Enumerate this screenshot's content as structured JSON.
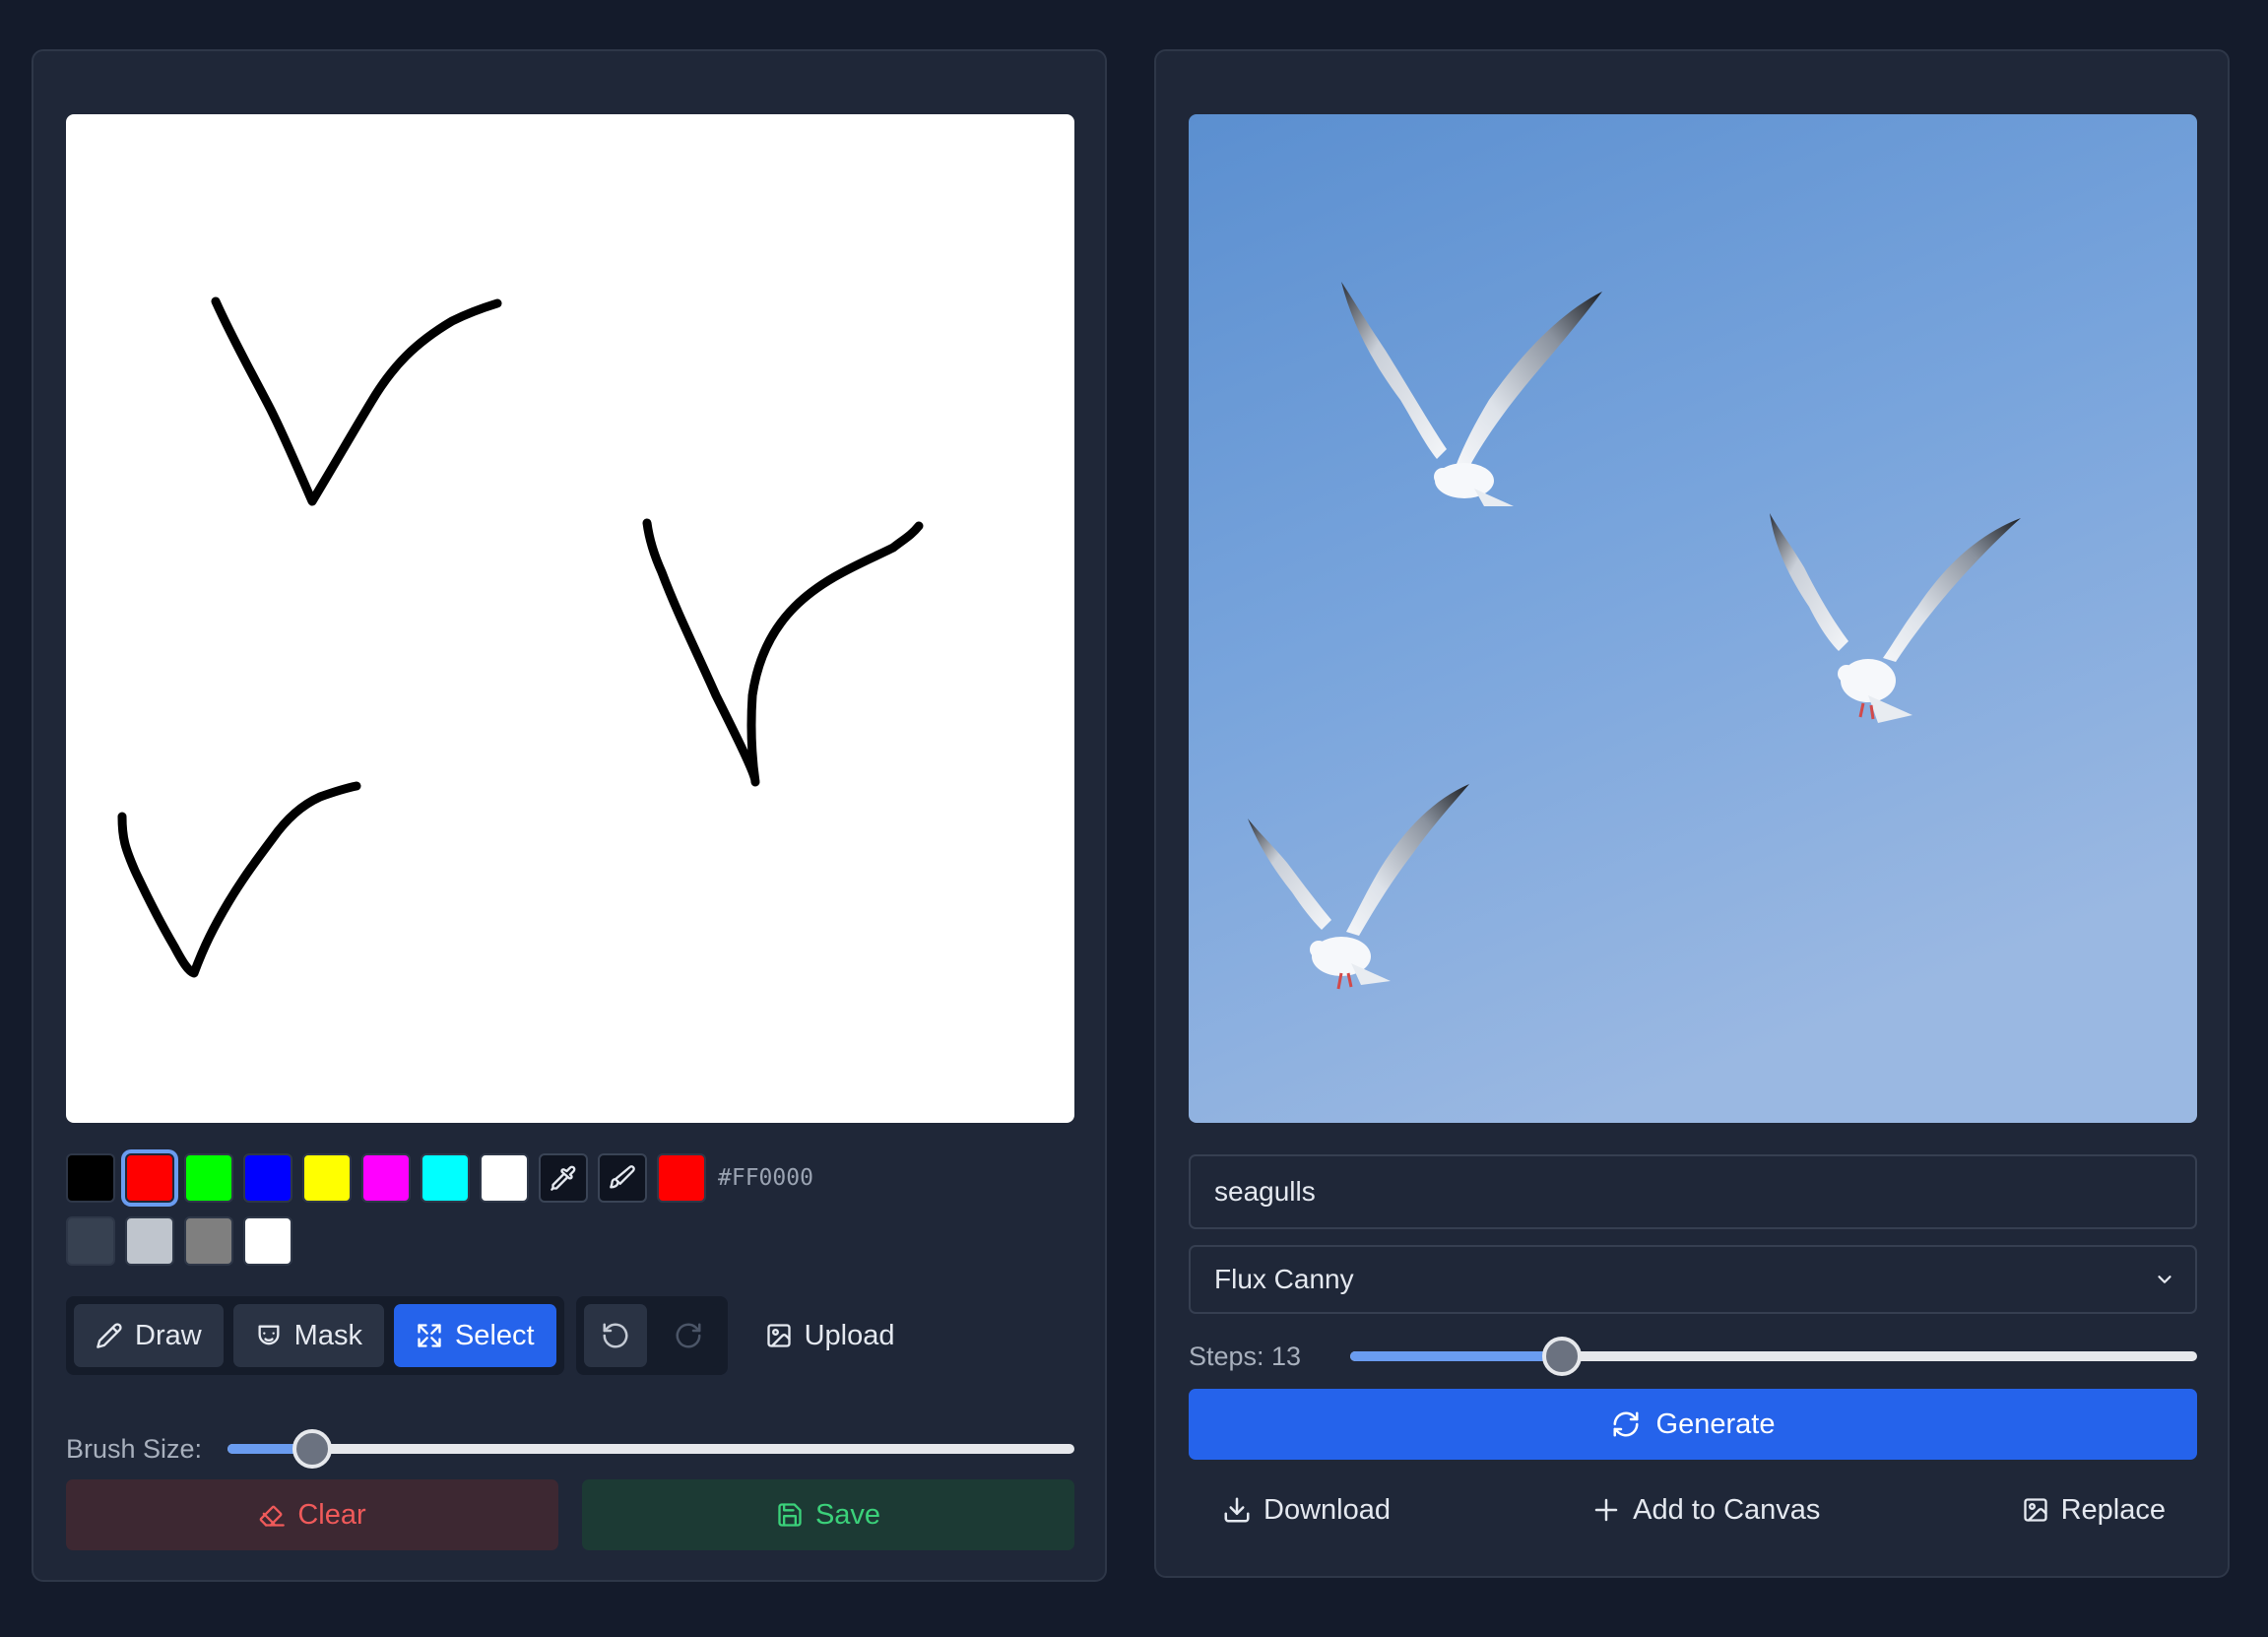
{
  "editor": {
    "palette": {
      "colors": [
        "#000000",
        "#FF0000",
        "#00FF00",
        "#0000FF",
        "#FFFF00",
        "#FF00FF",
        "#00FFFF",
        "#FFFFFF"
      ],
      "selected_color": "#FF0000",
      "current_color_hex": "#FF0000",
      "secondary_colors": [
        "#374151",
        "#BFC5CD",
        "#7F7F7F",
        "#FFFFFF"
      ],
      "eyedropper_icon": "eyedropper-icon",
      "brush_icon": "brush-icon"
    },
    "modes": {
      "draw_label": "Draw",
      "mask_label": "Mask",
      "select_label": "Select",
      "active": "Select"
    },
    "upload_label": "Upload",
    "brush_size": {
      "label": "Brush Size:",
      "fraction": 0.1
    },
    "clear_label": "Clear",
    "save_label": "Save"
  },
  "generator": {
    "prompt_value": "seagulls",
    "model_selected": "Flux Canny",
    "steps": {
      "label": "Steps: 13",
      "value": 13,
      "fraction": 0.25
    },
    "generate_label": "Generate",
    "download_label": "Download",
    "add_to_canvas_label": "Add to Canvas",
    "replace_label": "Replace"
  }
}
